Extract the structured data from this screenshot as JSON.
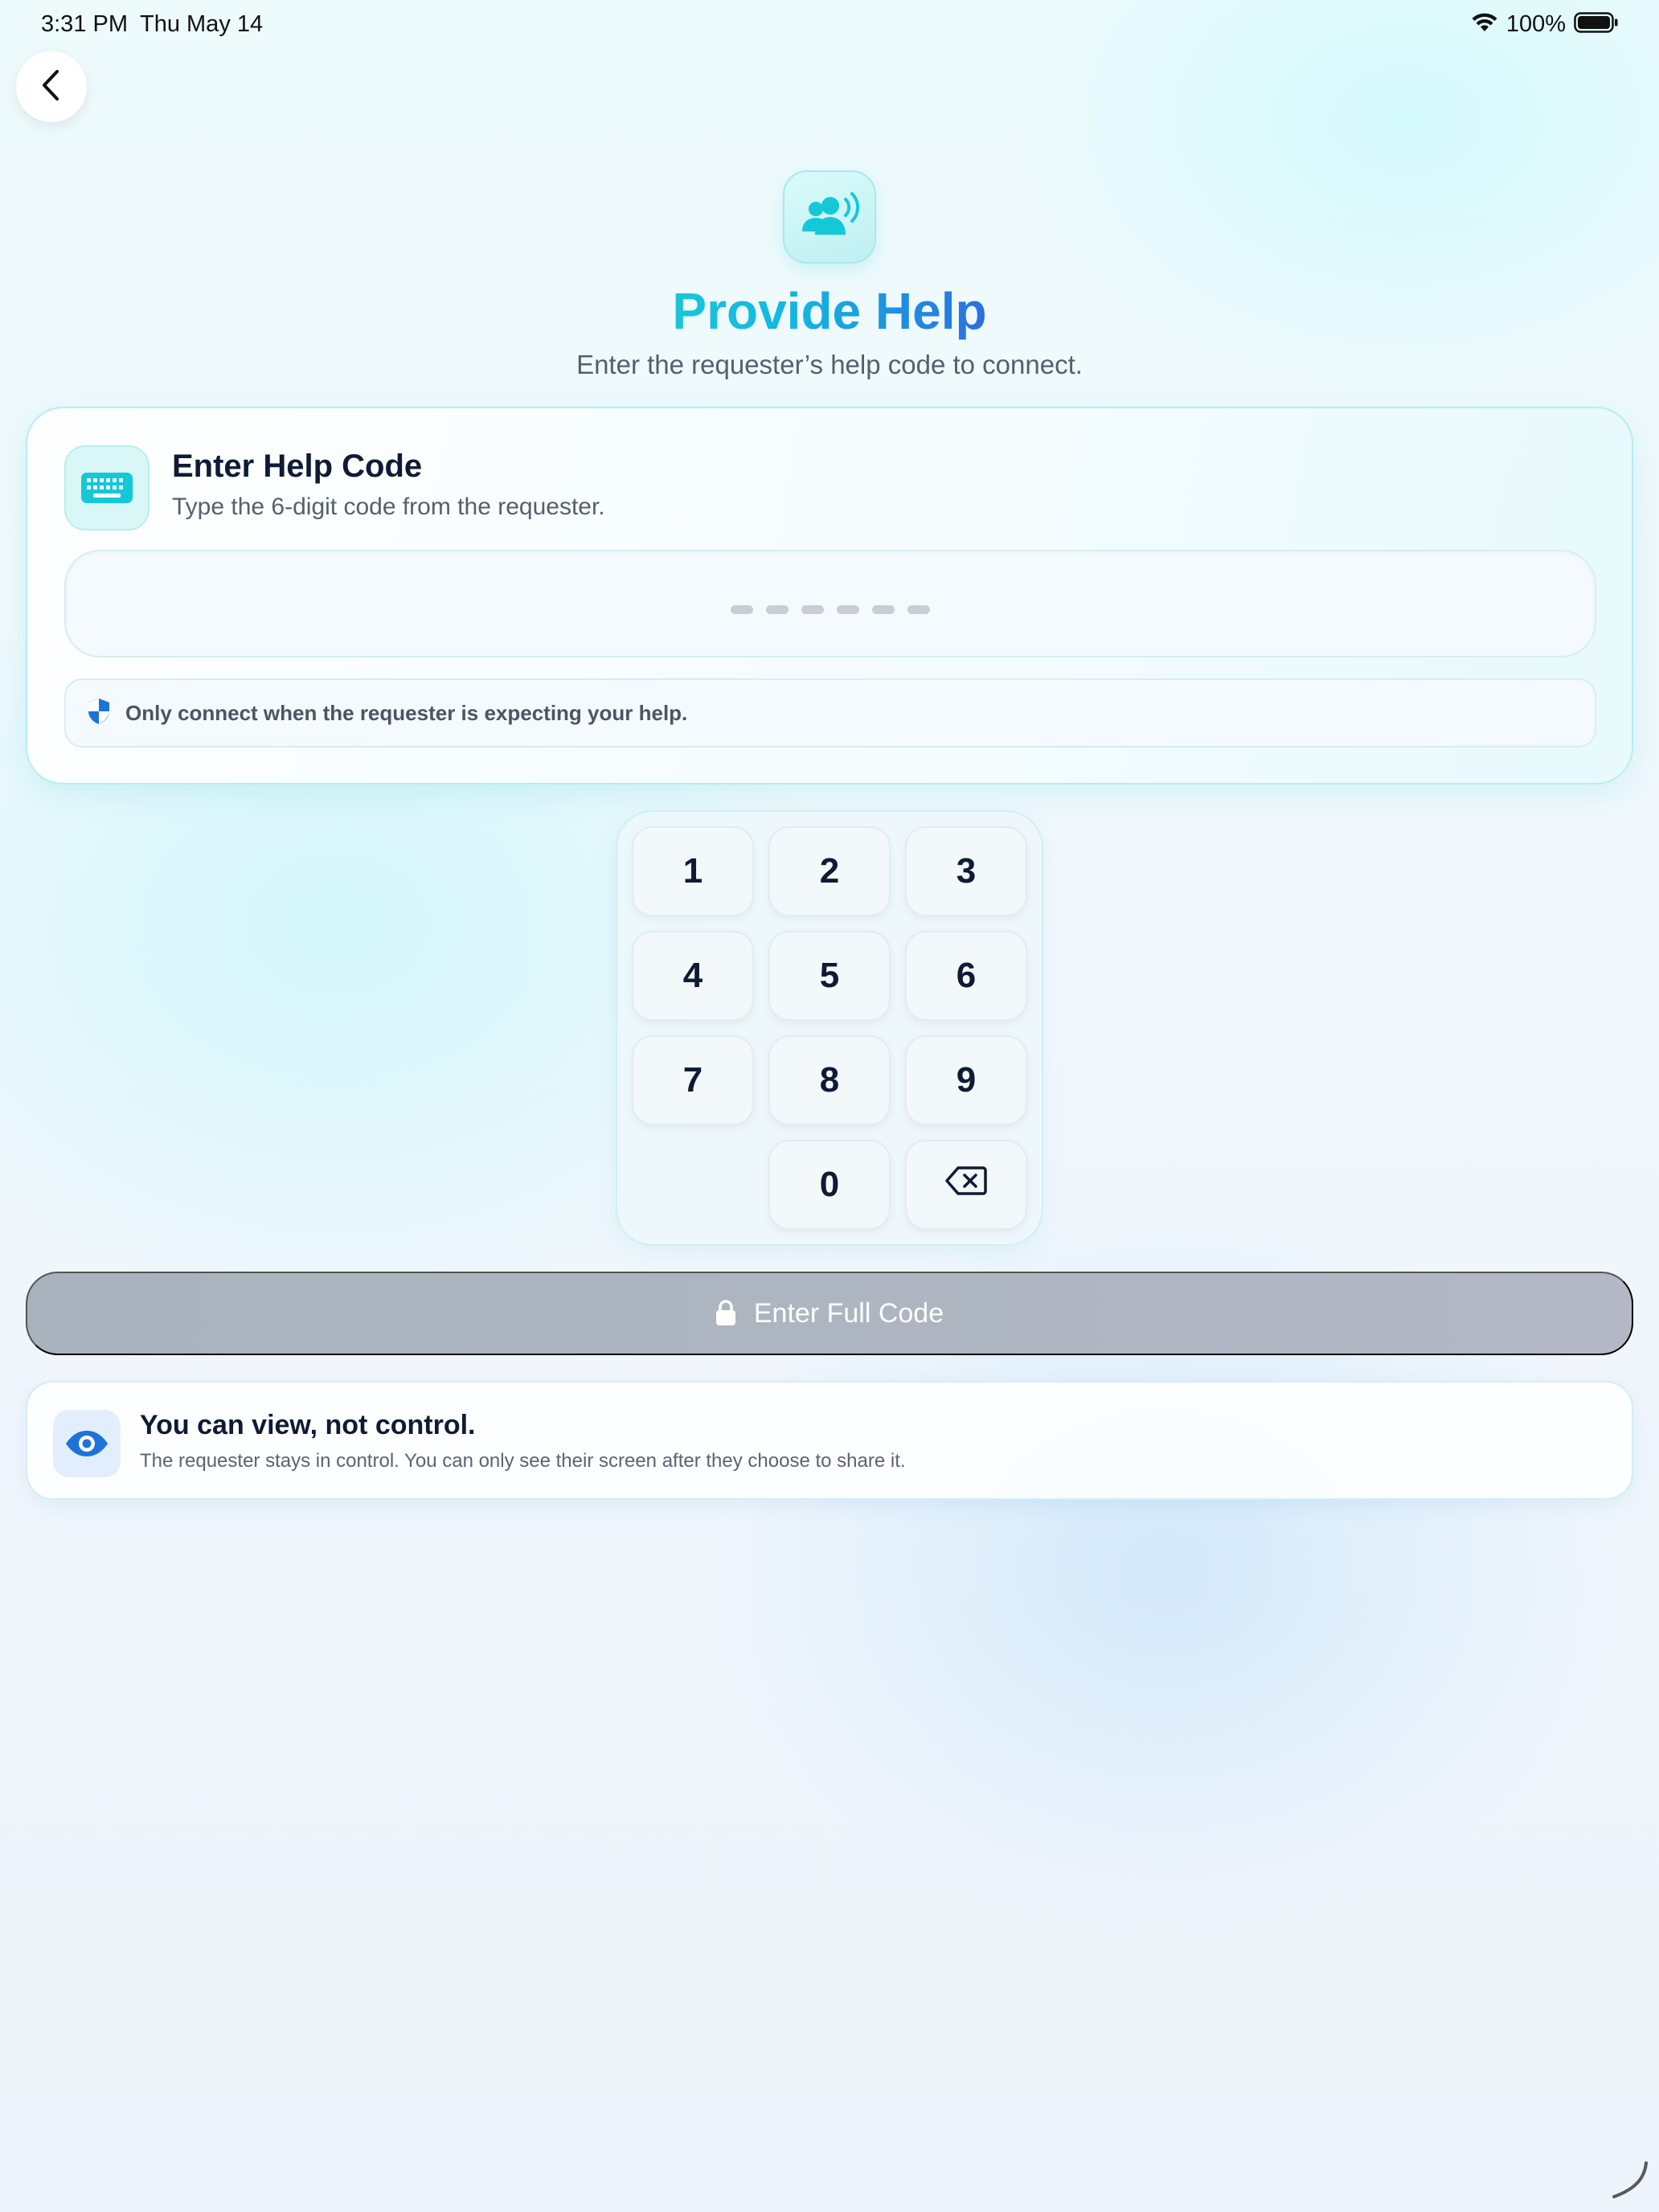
{
  "status_bar": {
    "time": "3:31 PM",
    "date": "Thu May 14",
    "battery_percent": "100%",
    "icons": [
      "wifi-icon",
      "battery-icon"
    ]
  },
  "header": {
    "back_icon": "chevron-left-icon",
    "hero_icon": "people-broadcast-icon",
    "title": "Provide Help",
    "subtitle": "Enter the requester’s help code to connect."
  },
  "code_card": {
    "icon": "keyboard-icon",
    "title": "Enter Help Code",
    "subtitle": "Type the 6-digit code from the requester.",
    "code_value": "",
    "code_length": 6,
    "notice_icon": "shield-icon",
    "notice": "Only connect when the requester is expecting your help."
  },
  "keypad": {
    "keys": [
      "1",
      "2",
      "3",
      "4",
      "5",
      "6",
      "7",
      "8",
      "9",
      "0"
    ],
    "delete_icon": "backspace-icon"
  },
  "submit": {
    "icon": "lock-icon",
    "label": "Enter Full Code",
    "enabled": false
  },
  "info": {
    "icon": "eye-icon",
    "title": "You can view, not control.",
    "body": "The requester stays in control. You can only see their screen after they choose to share it."
  },
  "colors": {
    "accent_teal": "#14c8d8",
    "accent_blue": "#2a6fe0",
    "text_dark": "#0f1b35",
    "text_muted": "#54606e",
    "disabled_button": "#adb5c0"
  }
}
